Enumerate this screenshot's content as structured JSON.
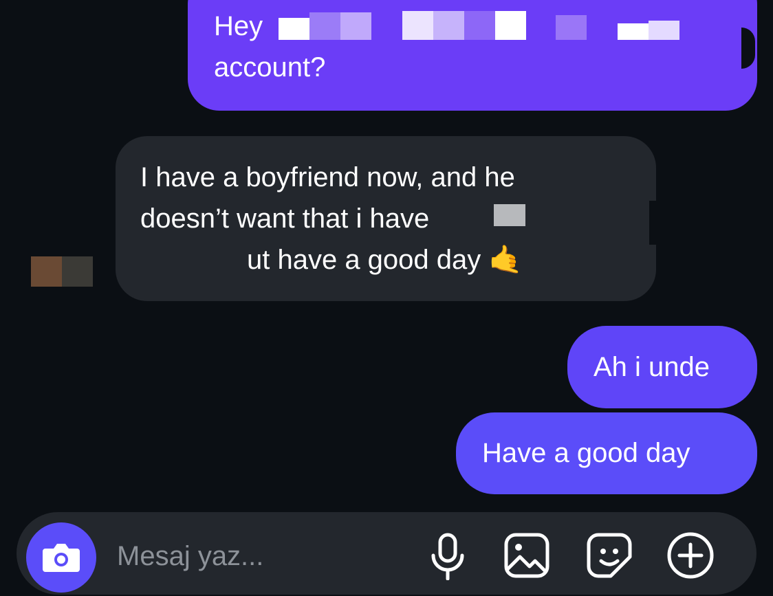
{
  "messages": [
    {
      "direction": "outgoing",
      "lines": [
        "Hey",
        "account?"
      ]
    },
    {
      "direction": "incoming",
      "lines": [
        "I have a boyfriend now, and he",
        "doesn’t want that i have",
        "ut have a good day"
      ],
      "emoji": "🤙"
    },
    {
      "direction": "outgoing",
      "lines": [
        "Ah i unde"
      ]
    },
    {
      "direction": "outgoing",
      "lines": [
        "Have a good day"
      ]
    }
  ],
  "composer": {
    "placeholder": "Mesaj yaz...",
    "camera_icon": "camera-icon",
    "mic_icon": "microphone-icon",
    "gallery_icon": "image-icon",
    "sticker_icon": "sticker-icon",
    "add_icon": "plus-circle-icon"
  },
  "colors": {
    "background": "#0b0f14",
    "outgoing_bubble": "#6b3df7",
    "outgoing_bubble_blue": "#5b4df9",
    "incoming_bubble": "#23272d",
    "accent": "#5b4df9"
  }
}
